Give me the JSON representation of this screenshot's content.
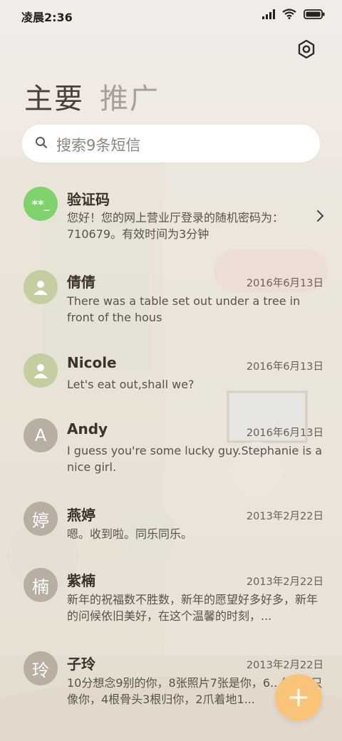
{
  "status_bar": {
    "time": "凌晨2:36"
  },
  "tabs": [
    {
      "label": "主要"
    },
    {
      "label": "推广"
    }
  ],
  "search": {
    "placeholder": "搜索9条短信"
  },
  "colors": {
    "accent": "#f9c47a",
    "green_avatar": "#7fd36c",
    "contact_avatar": "#c4cea0",
    "letter_avatar": "#b9aea2"
  },
  "messages": [
    {
      "name": "验证码",
      "avatar": "**_",
      "avatar_style": "green",
      "date": "",
      "snippet": "您好！您的网上营业厅登录的随机密码为：710679。有效时间为3分钟",
      "icon": "chevron-right-icon"
    },
    {
      "name": "倩倩",
      "avatar": "person-icon",
      "avatar_style": "contact",
      "date": "2016年6月13日",
      "snippet": "There was a table set out under a tree in front of the hous"
    },
    {
      "name": "Nicole",
      "avatar": "person-icon",
      "avatar_style": "contact",
      "date": "2016年6月13日",
      "snippet": "Let's eat out,shall we?"
    },
    {
      "name": "Andy",
      "avatar": "A",
      "avatar_style": "letter",
      "date": "2016年6月13日",
      "snippet": "I guess you're some lucky guy.Stephanie is a nice girl."
    },
    {
      "name": "燕婷",
      "avatar": "婷",
      "avatar_style": "letter",
      "date": "2013年2月22日",
      "snippet": "嗯。收到啦。同乐同乐。"
    },
    {
      "name": "紫楠",
      "avatar": "楠",
      "avatar_style": "letter",
      "date": "2013年2月22日",
      "snippet": "新年的祝福数不胜数，新年的愿望好多好多，新年的问候依旧美好，在这个温馨的时刻，..."
    },
    {
      "name": "子玲",
      "avatar": "玲",
      "avatar_style": "letter",
      "date": "2013年2月22日",
      "snippet": "10分想念9别的你，8张照片7张是你，6...你，5只像你，4根骨头3根归你，2爪着地1..."
    }
  ],
  "fab": {
    "icon": "plus-icon"
  }
}
